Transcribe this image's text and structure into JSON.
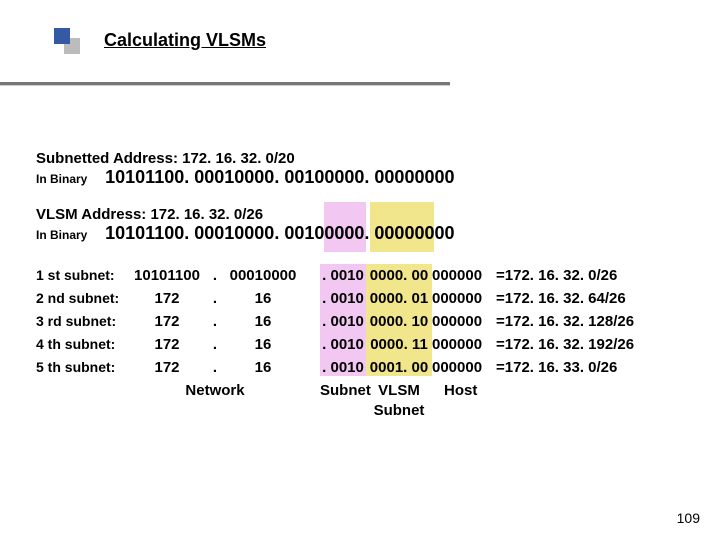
{
  "title": "Calculating VLSMs",
  "subnetted": {
    "label": "Subnetted Address: 172. 16. 32. 0/20",
    "binlabel": "In Binary",
    "binary": "10101100. 00010000. 00100000. 00000000"
  },
  "vlsm": {
    "label": "VLSM Address: 172. 16. 32. 0/26",
    "binlabel": "In Binary",
    "binary": "10101100. 00010000. 00100000. 00000000"
  },
  "rows": [
    {
      "label": "1 st subnet:",
      "o1": "10101100",
      "o2": "00010000",
      "sub": ". 0010",
      "vlsm": "0000. 00",
      "host": "000000",
      "res": "=172. 16. 32. 0/26"
    },
    {
      "label": "2 nd subnet:",
      "o1": "172",
      "o2": "16",
      "sub": ". 0010",
      "vlsm": "0000. 01",
      "host": "000000",
      "res": "=172. 16. 32. 64/26"
    },
    {
      "label": "3 rd subnet:",
      "o1": "172",
      "o2": "16",
      "sub": ". 0010",
      "vlsm": "0000. 10",
      "host": "000000",
      "res": "=172. 16. 32. 128/26"
    },
    {
      "label": "4 th subnet:",
      "o1": "172",
      "o2": "16",
      "sub": ". 0010",
      "vlsm": "0000. 11",
      "host": "000000",
      "res": "=172. 16. 32. 192/26"
    },
    {
      "label": "5 th subnet:",
      "o1": "172",
      "o2": "16",
      "sub": ". 0010",
      "vlsm": "0001. 00",
      "host": "000000",
      "res": "=172. 16. 33. 0/26"
    }
  ],
  "headers": {
    "net": "Network",
    "sub": "Subnet",
    "vlsm": "VLSM",
    "vlsm2": "Subnet",
    "host": "Host"
  },
  "pagenum": "109"
}
